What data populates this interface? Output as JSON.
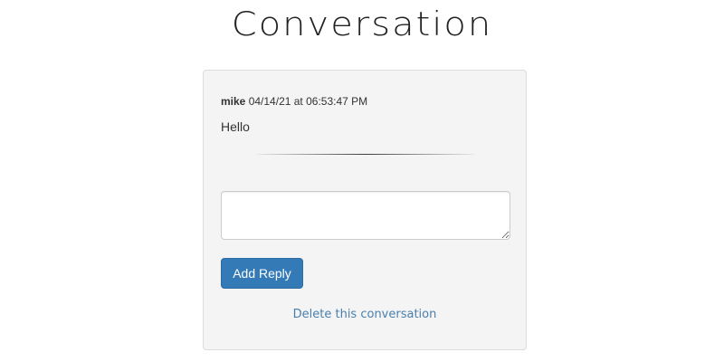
{
  "page": {
    "title": "Conversation"
  },
  "message": {
    "author": "mike",
    "timestamp": "04/14/21 at 06:53:47 PM",
    "body": "Hello"
  },
  "reply": {
    "value": "",
    "placeholder": "",
    "button_label": "Add Reply"
  },
  "actions": {
    "delete_label": "Delete this conversation"
  },
  "colors": {
    "primary_button": "#337ab7",
    "link": "#4a7fad",
    "panel_background": "#f4f4f4"
  }
}
